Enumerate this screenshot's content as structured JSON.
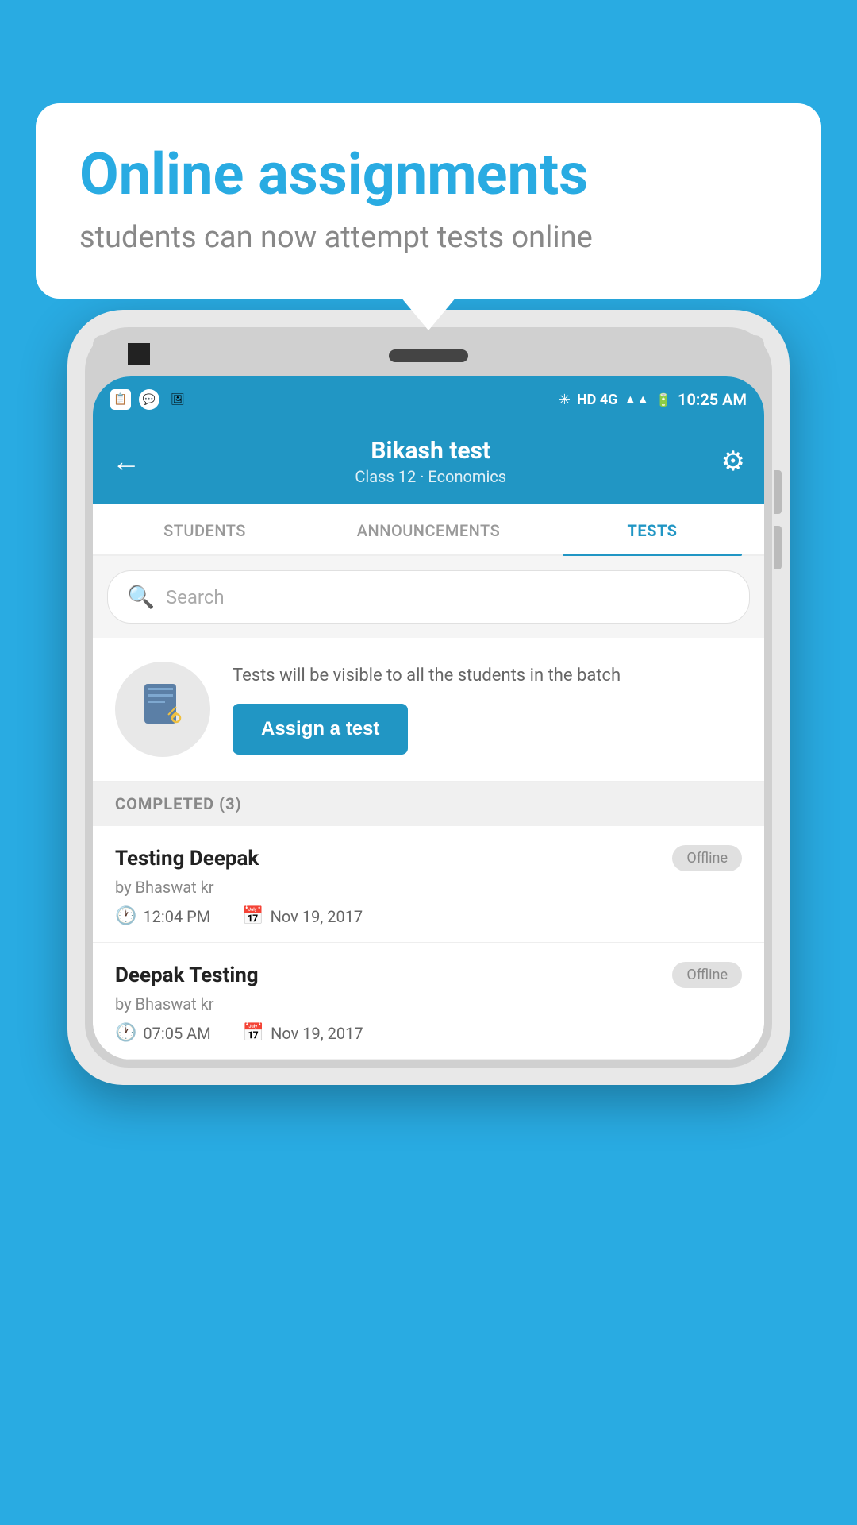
{
  "background_color": "#29ABE2",
  "bubble": {
    "title": "Online assignments",
    "subtitle": "students can now attempt tests online"
  },
  "phone": {
    "status_bar": {
      "time": "10:25 AM",
      "network": "HD 4G"
    },
    "header": {
      "title": "Bikash test",
      "subtitle": "Class 12 · Economics",
      "back_label": "←",
      "settings_label": "⚙"
    },
    "tabs": [
      {
        "label": "STUDENTS",
        "active": false
      },
      {
        "label": "ANNOUNCEMENTS",
        "active": false
      },
      {
        "label": "TESTS",
        "active": true
      }
    ],
    "search": {
      "placeholder": "Search"
    },
    "assign_section": {
      "description": "Tests will be visible to all the students in the batch",
      "button_label": "Assign a test"
    },
    "completed_section": {
      "header": "COMPLETED (3)",
      "items": [
        {
          "title": "Testing Deepak",
          "by": "by Bhaswat kr",
          "time": "12:04 PM",
          "date": "Nov 19, 2017",
          "badge": "Offline"
        },
        {
          "title": "Deepak Testing",
          "by": "by Bhaswat kr",
          "time": "07:05 AM",
          "date": "Nov 19, 2017",
          "badge": "Offline"
        }
      ]
    }
  }
}
